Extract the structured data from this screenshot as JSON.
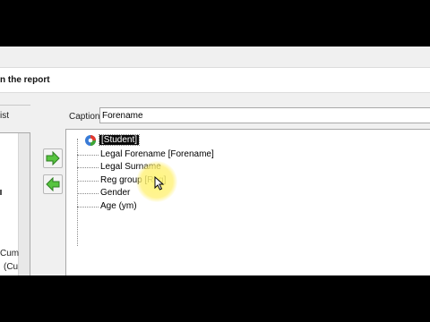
{
  "window": {
    "title": "n the report"
  },
  "left_panel": {
    "label": "ist",
    "text_line1": "Cum",
    "text_line2": "(Cu"
  },
  "buttons": {
    "add_icon": "right-arrow-icon",
    "remove_icon": "left-arrow-icon"
  },
  "caption": {
    "label": "Caption",
    "value": "Forename"
  },
  "tree": {
    "root": "[Student]",
    "items": [
      "Legal Forename [Forename]",
      "Legal Surname",
      "Reg group [Reg]",
      "Gender",
      "Age (ym)"
    ]
  },
  "colors": {
    "arrow_green": "#3fa535",
    "selection_bg": "#0a0a0a",
    "cursor_highlight": "#fff47a"
  }
}
